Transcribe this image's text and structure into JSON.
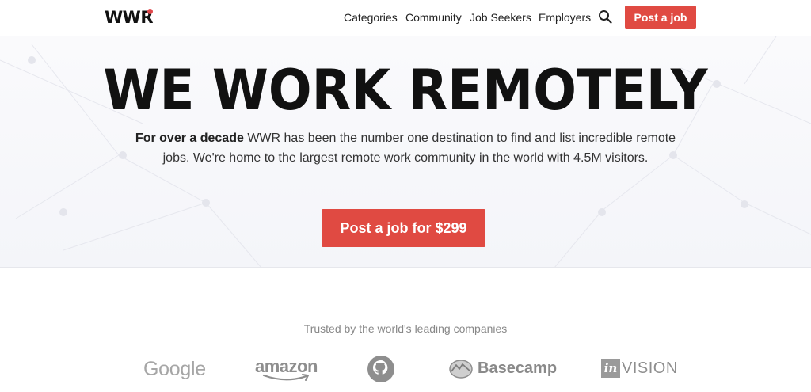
{
  "header": {
    "logo_text": "WWR",
    "nav": [
      {
        "label": "Categories"
      },
      {
        "label": "Community"
      },
      {
        "label": "Job Seekers"
      },
      {
        "label": "Employers"
      }
    ],
    "post_job_label": "Post a job"
  },
  "hero": {
    "title": "WE WORK REMOTELY",
    "lead_bold": "For over a decade",
    "lead_rest": " WWR has been the number one destination to find and list incredible remote jobs. We're home to the largest remote work community in the world with 4.5M visitors.",
    "cta_label": "Post a job for $299"
  },
  "trusted": {
    "heading": "Trusted by the world's leading companies",
    "logos": [
      "Google",
      "amazon",
      "GitHub",
      "Basecamp",
      "InVision"
    ],
    "basecamp_label": "Basecamp",
    "invision_badge": "in",
    "invision_word": "VISION",
    "google_word": "Google",
    "amazon_word": "amazon"
  },
  "colors": {
    "accent": "#e04a42",
    "logo_dot": "#e0464a"
  }
}
